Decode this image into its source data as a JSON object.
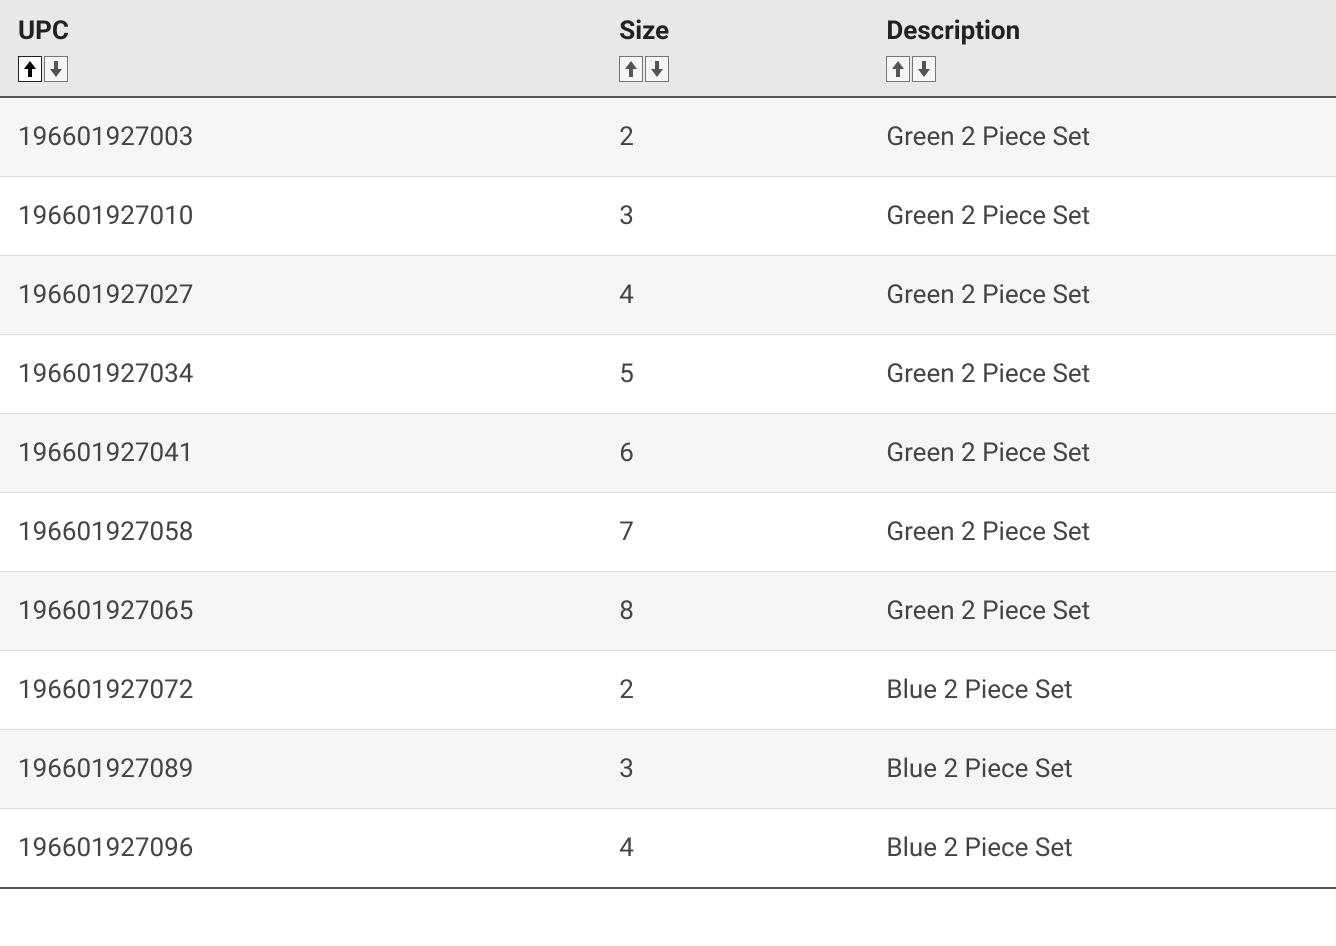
{
  "table": {
    "columns": [
      {
        "label": "UPC",
        "sort_active": "asc"
      },
      {
        "label": "Size",
        "sort_active": null
      },
      {
        "label": "Description",
        "sort_active": null
      }
    ],
    "rows": [
      {
        "upc": "196601927003",
        "size": "2",
        "description": "Green 2 Piece Set"
      },
      {
        "upc": "196601927010",
        "size": "3",
        "description": "Green 2 Piece Set"
      },
      {
        "upc": "196601927027",
        "size": "4",
        "description": "Green 2 Piece Set"
      },
      {
        "upc": "196601927034",
        "size": "5",
        "description": "Green 2 Piece Set"
      },
      {
        "upc": "196601927041",
        "size": "6",
        "description": "Green 2 Piece Set"
      },
      {
        "upc": "196601927058",
        "size": "7",
        "description": "Green 2 Piece Set"
      },
      {
        "upc": "196601927065",
        "size": "8",
        "description": "Green 2 Piece Set"
      },
      {
        "upc": "196601927072",
        "size": "2",
        "description": "Blue 2 Piece Set"
      },
      {
        "upc": "196601927089",
        "size": "3",
        "description": "Blue 2 Piece Set"
      },
      {
        "upc": "196601927096",
        "size": "4",
        "description": "Blue 2 Piece Set"
      }
    ]
  }
}
